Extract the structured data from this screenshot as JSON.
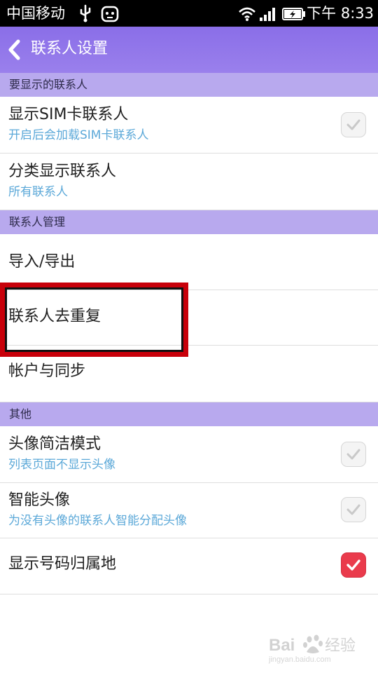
{
  "status_bar": {
    "carrier": "中国移动",
    "time": "下午 8:33",
    "icons": [
      "usb-icon",
      "alarm-icon",
      "wifi-icon",
      "signal-icon",
      "battery-charging-icon"
    ]
  },
  "header": {
    "back_icon": "chevron-left-icon",
    "title": "联系人设置"
  },
  "sections": [
    {
      "header": "要显示的联系人",
      "items": [
        {
          "title": "显示SIM卡联系人",
          "subtitle": "开启后会加载SIM卡联系人",
          "checkbox": false
        },
        {
          "title": "分类显示联系人",
          "subtitle": "所有联系人"
        }
      ]
    },
    {
      "header": "联系人管理",
      "items": [
        {
          "title": "导入/导出"
        },
        {
          "title": "联系人去重复",
          "highlighted": true
        },
        {
          "title": "帐户与同步"
        }
      ]
    },
    {
      "header": "其他",
      "items": [
        {
          "title": "头像简洁模式",
          "subtitle": "列表页面不显示头像",
          "checkbox": false
        },
        {
          "title": "智能头像",
          "subtitle": "为没有头像的联系人智能分配头像",
          "checkbox": false
        },
        {
          "title": "显示号码归属地",
          "checkbox": true
        }
      ]
    }
  ],
  "colors": {
    "title_bar": "#8a6ee8",
    "section_header": "#b8a9ee",
    "subtitle_text": "#5ba8d8",
    "checkbox_checked": "#ea3b4c",
    "highlight_border": "#c8000a"
  },
  "watermark": {
    "text": "Bai 经验",
    "url": "jingyan.baidu.com"
  }
}
